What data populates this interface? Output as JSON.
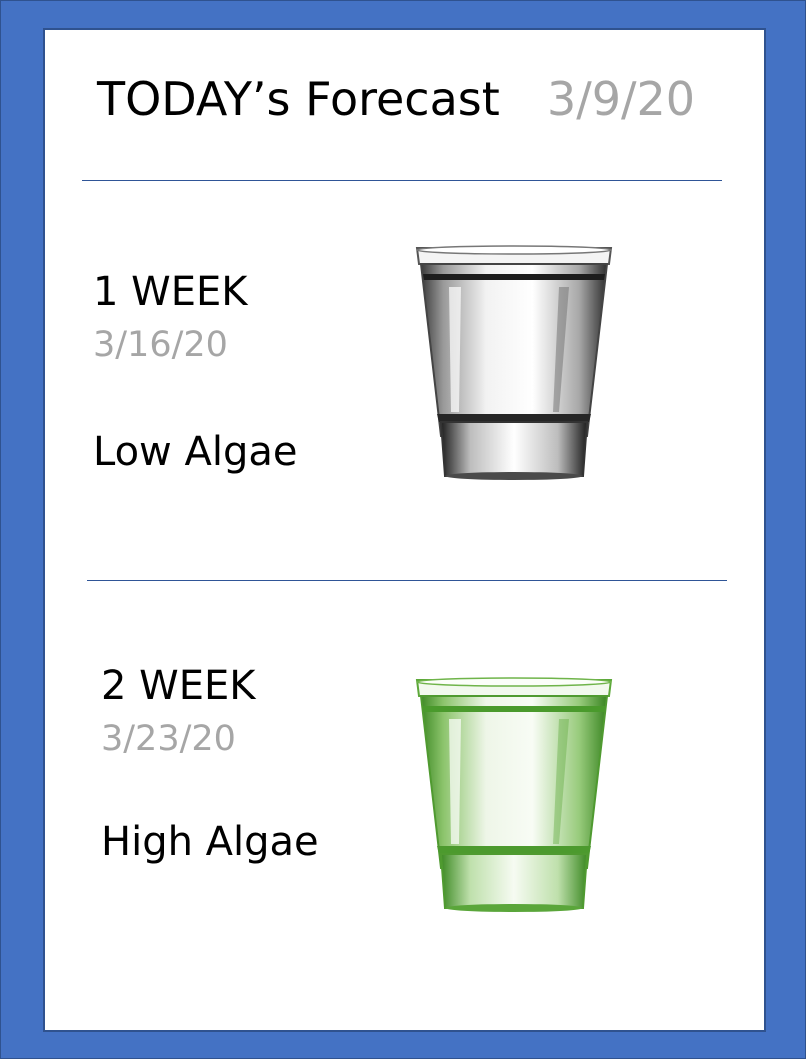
{
  "header": {
    "title": "TODAY’s Forecast",
    "date": "3/9/20"
  },
  "forecasts": [
    {
      "label": "1 WEEK",
      "date": "3/16/20",
      "level": "Low Algae",
      "glass_icon": "clear-water-glass-icon",
      "tint": "#9a9a9a"
    },
    {
      "label": "2 WEEK",
      "date": "3/23/20",
      "level": "High Algae",
      "glass_icon": "green-water-glass-icon",
      "tint": "#5da83a"
    }
  ],
  "colors": {
    "border": "#4472c4",
    "divider": "#2f5597",
    "date_text": "#a6a6a6"
  }
}
